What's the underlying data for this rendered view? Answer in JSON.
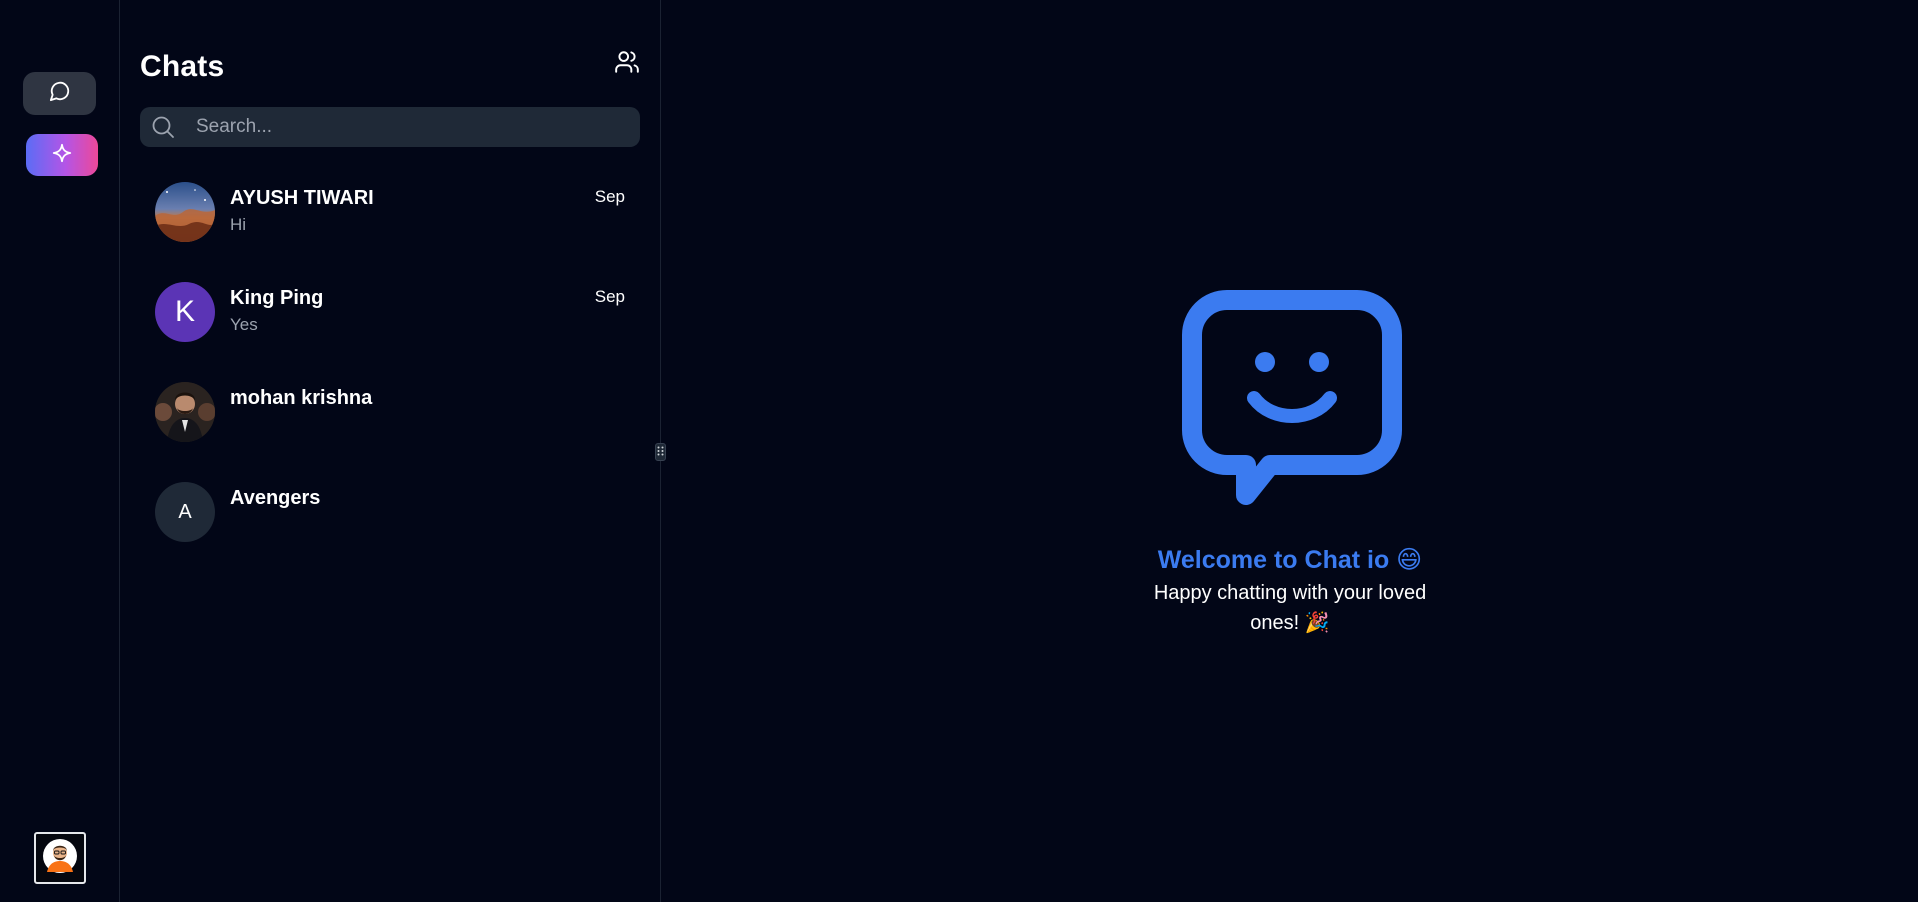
{
  "rail": {
    "chats_icon": "chat-bubble-icon",
    "ai_icon": "sparkle-icon",
    "profile_icon": "user-avatar-icon"
  },
  "panel": {
    "title": "Chats",
    "contacts_icon": "users-icon",
    "search": {
      "placeholder": "Search...",
      "value": ""
    }
  },
  "chats": [
    {
      "name": "AYUSH TIWARI",
      "preview": "Hi",
      "date": "Sep",
      "avatar": "image"
    },
    {
      "name": "King Ping",
      "preview": "Yes",
      "date": "Sep",
      "avatar_letter": "K",
      "avatar_color": "#5b34b5"
    },
    {
      "name": "mohan krishna",
      "preview": "",
      "date": "",
      "avatar": "image"
    },
    {
      "name": "Avengers",
      "preview": "",
      "date": "",
      "avatar_letter": "A",
      "avatar_color": "#1f2937"
    }
  ],
  "welcome": {
    "title": "Welcome to Chat io 😄",
    "subtitle": "Happy chatting with your loved ones! 🎉",
    "logo_icon": "smiley-chat-bubble-icon",
    "accent": "#3b7bf0"
  }
}
